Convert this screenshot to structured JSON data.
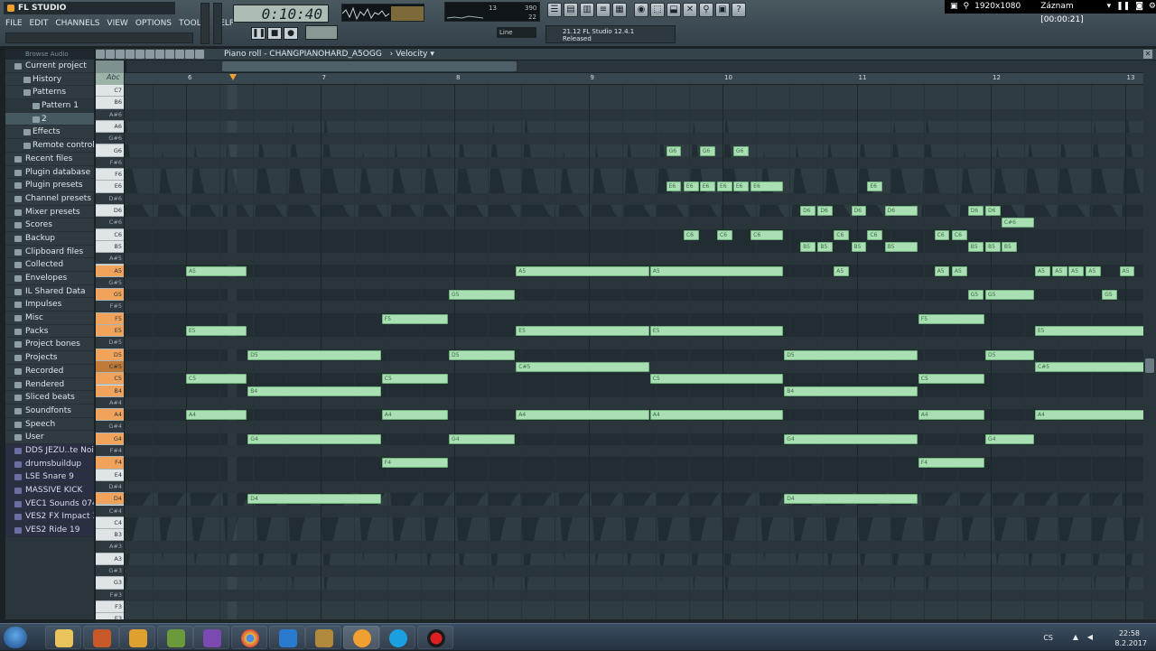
{
  "app": {
    "logo": "FL STUDIO",
    "menu": [
      "FILE",
      "EDIT",
      "CHANNELS",
      "VIEW",
      "OPTIONS",
      "TOOLS",
      "HELP"
    ],
    "time": "0:10:40",
    "hint_line1": "21.12 FL Studio 12.4.1",
    "hint_line2": "Released",
    "snap": "Line",
    "cpu_value": "13",
    "ram_value": "390",
    "poly_value": "22"
  },
  "recording": {
    "resolution": "1920x1080",
    "status": "Záznam [00:00:21]"
  },
  "browser": {
    "header": "Browse   Audio",
    "items": [
      {
        "label": "Current project",
        "level": 0,
        "type": "folder"
      },
      {
        "label": "History",
        "level": 1,
        "type": "folder"
      },
      {
        "label": "Patterns",
        "level": 1,
        "type": "folder"
      },
      {
        "label": "Pattern 1",
        "level": 2,
        "type": "item"
      },
      {
        "label": "2",
        "level": 2,
        "type": "item",
        "selected": true
      },
      {
        "label": "Effects",
        "level": 1,
        "type": "folder"
      },
      {
        "label": "Remote control",
        "level": 1,
        "type": "folder"
      },
      {
        "label": "Recent files",
        "level": 0,
        "type": "folder"
      },
      {
        "label": "Plugin database",
        "level": 0,
        "type": "folder"
      },
      {
        "label": "Plugin presets",
        "level": 0,
        "type": "folder"
      },
      {
        "label": "Channel presets",
        "level": 0,
        "type": "folder"
      },
      {
        "label": "Mixer presets",
        "level": 0,
        "type": "folder"
      },
      {
        "label": "Scores",
        "level": 0,
        "type": "folder"
      },
      {
        "label": "Backup",
        "level": 0,
        "type": "folder"
      },
      {
        "label": "Clipboard files",
        "level": 0,
        "type": "folder"
      },
      {
        "label": "Collected",
        "level": 0,
        "type": "folder"
      },
      {
        "label": "Envelopes",
        "level": 0,
        "type": "folder"
      },
      {
        "label": "IL Shared Data",
        "level": 0,
        "type": "folder"
      },
      {
        "label": "Impulses",
        "level": 0,
        "type": "folder"
      },
      {
        "label": "Misc",
        "level": 0,
        "type": "folder"
      },
      {
        "label": "Packs",
        "level": 0,
        "type": "folder"
      },
      {
        "label": "Project bones",
        "level": 0,
        "type": "folder"
      },
      {
        "label": "Projects",
        "level": 0,
        "type": "folder"
      },
      {
        "label": "Recorded",
        "level": 0,
        "type": "folder"
      },
      {
        "label": "Rendered",
        "level": 0,
        "type": "folder"
      },
      {
        "label": "Sliced beats",
        "level": 0,
        "type": "folder"
      },
      {
        "label": "Soundfonts",
        "level": 0,
        "type": "folder"
      },
      {
        "label": "Speech",
        "level": 0,
        "type": "folder"
      },
      {
        "label": "User",
        "level": 0,
        "type": "folder"
      },
      {
        "label": "DDS JEZU..te Noise 1",
        "level": 0,
        "type": "sample"
      },
      {
        "label": "drumsbuildup",
        "level": 0,
        "type": "sample"
      },
      {
        "label": "LSE Snare 9",
        "level": 0,
        "type": "sample"
      },
      {
        "label": "MASSIVE KICK",
        "level": 0,
        "type": "sample"
      },
      {
        "label": "VEC1 Sounds 074 E",
        "level": 0,
        "type": "sample"
      },
      {
        "label": "VES2 FX Impact 33",
        "level": 0,
        "type": "sample"
      },
      {
        "label": "VES2 Ride 19",
        "level": 0,
        "type": "sample"
      }
    ]
  },
  "pianoroll": {
    "title": "Piano roll - CHANGPIANOHARD_A5OGG",
    "mode": "Velocity",
    "key_header": "Abc",
    "bars": [
      "6",
      "7",
      "8",
      "9",
      "10",
      "11",
      "12",
      "13"
    ],
    "keys_top_to_bottom": [
      "C7",
      "B6",
      "A#6",
      "A6",
      "G#6",
      "G6",
      "F#6",
      "F6",
      "E6",
      "D#6",
      "D6",
      "C#6",
      "C6",
      "B5",
      "A#5",
      "A5",
      "G#5",
      "G5",
      "F#5",
      "F5",
      "E5",
      "D#5",
      "D5",
      "C#5",
      "C5",
      "B4",
      "A#4",
      "A4",
      "G#4",
      "G4",
      "F#4",
      "F4",
      "E4",
      "D#4",
      "D4",
      "C#4",
      "C4",
      "B3",
      "A#3",
      "A3",
      "G#3",
      "G3",
      "F#3",
      "F3",
      "E3"
    ],
    "highlighted_keys": [
      "A5",
      "G5",
      "F5",
      "E5",
      "D5",
      "C#5",
      "C5",
      "B4",
      "A4",
      "G4",
      "F4",
      "D4"
    ],
    "notes": [
      {
        "label": "A5",
        "key": "A5",
        "start": 0,
        "len": 0.46
      },
      {
        "label": "E5",
        "key": "E5",
        "start": 0,
        "len": 0.46
      },
      {
        "label": "C5",
        "key": "C5",
        "start": 0,
        "len": 0.46
      },
      {
        "label": "A4",
        "key": "A4",
        "start": 0,
        "len": 0.46
      },
      {
        "label": "D5",
        "key": "D5",
        "start": 0.46,
        "len": 1.0
      },
      {
        "label": "B4",
        "key": "B4",
        "start": 0.46,
        "len": 1.0
      },
      {
        "label": "G4",
        "key": "G4",
        "start": 0.46,
        "len": 1.0
      },
      {
        "label": "D4",
        "key": "D4",
        "start": 0.46,
        "len": 1.0
      },
      {
        "label": "F5",
        "key": "F5",
        "start": 1.46,
        "len": 0.5
      },
      {
        "label": "C5",
        "key": "C5",
        "start": 1.46,
        "len": 0.5
      },
      {
        "label": "A4",
        "key": "A4",
        "start": 1.46,
        "len": 0.5
      },
      {
        "label": "F4",
        "key": "F4",
        "start": 1.46,
        "len": 0.5
      },
      {
        "label": "G5",
        "key": "G5",
        "start": 1.96,
        "len": 0.5
      },
      {
        "label": "D5",
        "key": "D5",
        "start": 1.96,
        "len": 0.5
      },
      {
        "label": "G4",
        "key": "G4",
        "start": 1.96,
        "len": 0.5
      },
      {
        "label": "A5",
        "key": "A5",
        "start": 2.46,
        "len": 1.0
      },
      {
        "label": "E5",
        "key": "E5",
        "start": 2.46,
        "len": 1.0
      },
      {
        "label": "C#5",
        "key": "C#5",
        "start": 2.46,
        "len": 1.0
      },
      {
        "label": "A4",
        "key": "A4",
        "start": 2.46,
        "len": 1.0
      },
      {
        "label": "G6",
        "key": "G6",
        "start": 3.58,
        "len": 0.12
      },
      {
        "label": "G6",
        "key": "G6",
        "start": 3.83,
        "len": 0.12
      },
      {
        "label": "G6",
        "key": "G6",
        "start": 4.08,
        "len": 0.12
      },
      {
        "label": "E6",
        "key": "E6",
        "start": 3.58,
        "len": 0.12
      },
      {
        "label": "E6",
        "key": "E6",
        "start": 3.71,
        "len": 0.12
      },
      {
        "label": "E6",
        "key": "E6",
        "start": 3.83,
        "len": 0.12
      },
      {
        "label": "E6",
        "key": "E6",
        "start": 3.96,
        "len": 0.12
      },
      {
        "label": "E6",
        "key": "E6",
        "start": 4.08,
        "len": 0.12
      },
      {
        "label": "E6",
        "key": "E6",
        "start": 4.21,
        "len": 0.25
      },
      {
        "label": "C6",
        "key": "C6",
        "start": 3.71,
        "len": 0.12
      },
      {
        "label": "C6",
        "key": "C6",
        "start": 3.96,
        "len": 0.12
      },
      {
        "label": "C6",
        "key": "C6",
        "start": 4.21,
        "len": 0.25
      },
      {
        "label": "A5",
        "key": "A5",
        "start": 3.46,
        "len": 1.0
      },
      {
        "label": "E5",
        "key": "E5",
        "start": 3.46,
        "len": 1.0
      },
      {
        "label": "C5",
        "key": "C5",
        "start": 3.46,
        "len": 1.0
      },
      {
        "label": "A4",
        "key": "A4",
        "start": 3.46,
        "len": 1.0
      },
      {
        "label": "D6",
        "key": "D6",
        "start": 4.58,
        "len": 0.12
      },
      {
        "label": "D6",
        "key": "D6",
        "start": 4.71,
        "len": 0.12
      },
      {
        "label": "D6",
        "key": "D6",
        "start": 4.96,
        "len": 0.12
      },
      {
        "label": "D6",
        "key": "D6",
        "start": 5.21,
        "len": 0.25
      },
      {
        "label": "B5",
        "key": "B5",
        "start": 4.58,
        "len": 0.12
      },
      {
        "label": "B5",
        "key": "B5",
        "start": 4.71,
        "len": 0.12
      },
      {
        "label": "B5",
        "key": "B5",
        "start": 4.96,
        "len": 0.12
      },
      {
        "label": "B5",
        "key": "B5",
        "start": 5.21,
        "len": 0.25
      },
      {
        "label": "C6",
        "key": "C6",
        "start": 4.83,
        "len": 0.12
      },
      {
        "label": "C6",
        "key": "C6",
        "start": 5.08,
        "len": 0.12
      },
      {
        "label": "E6",
        "key": "E6",
        "start": 5.08,
        "len": 0.12
      },
      {
        "label": "A5",
        "key": "A5",
        "start": 4.83,
        "len": 0.12
      },
      {
        "label": "D5",
        "key": "D5",
        "start": 4.46,
        "len": 1.0
      },
      {
        "label": "B4",
        "key": "B4",
        "start": 4.46,
        "len": 1.0
      },
      {
        "label": "G4",
        "key": "G4",
        "start": 4.46,
        "len": 1.0
      },
      {
        "label": "D4",
        "key": "D4",
        "start": 4.46,
        "len": 1.0
      },
      {
        "label": "F5",
        "key": "F5",
        "start": 5.46,
        "len": 0.5
      },
      {
        "label": "C5",
        "key": "C5",
        "start": 5.46,
        "len": 0.5
      },
      {
        "label": "A4",
        "key": "A4",
        "start": 5.46,
        "len": 0.5
      },
      {
        "label": "F4",
        "key": "F4",
        "start": 5.46,
        "len": 0.5
      },
      {
        "label": "C6",
        "key": "C6",
        "start": 5.58,
        "len": 0.12
      },
      {
        "label": "C6",
        "key": "C6",
        "start": 5.71,
        "len": 0.12
      },
      {
        "label": "A5",
        "key": "A5",
        "start": 5.58,
        "len": 0.12
      },
      {
        "label": "A5",
        "key": "A5",
        "start": 5.71,
        "len": 0.12
      },
      {
        "label": "B5",
        "key": "B5",
        "start": 5.83,
        "len": 0.12
      },
      {
        "label": "B5",
        "key": "B5",
        "start": 5.96,
        "len": 0.12
      },
      {
        "label": "B5",
        "key": "B5",
        "start": 6.08,
        "len": 0.12
      },
      {
        "label": "G5",
        "key": "G5",
        "start": 5.83,
        "len": 0.12
      },
      {
        "label": "G5",
        "key": "G5",
        "start": 5.96,
        "len": 0.37
      },
      {
        "label": "D6",
        "key": "D6",
        "start": 5.83,
        "len": 0.12
      },
      {
        "label": "D6",
        "key": "D6",
        "start": 5.96,
        "len": 0.12
      },
      {
        "label": "C#6",
        "key": "C#6",
        "start": 6.08,
        "len": 0.25
      },
      {
        "label": "D5",
        "key": "D5",
        "start": 5.96,
        "len": 0.37
      },
      {
        "label": "G4",
        "key": "G4",
        "start": 5.96,
        "len": 0.37
      },
      {
        "label": "A5",
        "key": "A5",
        "start": 6.33,
        "len": 0.12
      },
      {
        "label": "A5",
        "key": "A5",
        "start": 6.46,
        "len": 0.12
      },
      {
        "label": "A5",
        "key": "A5",
        "start": 6.58,
        "len": 0.12
      },
      {
        "label": "A5",
        "key": "A5",
        "start": 6.71,
        "len": 0.12
      },
      {
        "label": "A5",
        "key": "A5",
        "start": 6.96,
        "len": 0.12
      },
      {
        "label": "A5",
        "key": "A5",
        "start": 7.21,
        "len": 0.25
      },
      {
        "label": "G5",
        "key": "G5",
        "start": 6.83,
        "len": 0.12
      },
      {
        "label": "B5",
        "key": "B5",
        "start": 7.33,
        "len": 0.12
      },
      {
        "label": "E5",
        "key": "E5",
        "start": 6.33,
        "len": 1.13
      },
      {
        "label": "C#5",
        "key": "C#5",
        "start": 6.33,
        "len": 1.13
      },
      {
        "label": "A4",
        "key": "A4",
        "start": 6.33,
        "len": 1.13
      },
      {
        "label": "E5",
        "key": "E5",
        "start": 7.46,
        "len": 0.12
      },
      {
        "label": "C5",
        "key": "C5",
        "start": 7.46,
        "len": 0.12
      },
      {
        "label": "A4",
        "key": "A4",
        "start": 7.46,
        "len": 0.12
      }
    ]
  },
  "taskbar": {
    "language": "CS",
    "time": "22:58",
    "date": "8.2.2017"
  },
  "colors": {
    "note_fill": "#a9dfb2",
    "key_highlight": "#f1a35c",
    "accent": "#f0a030"
  }
}
